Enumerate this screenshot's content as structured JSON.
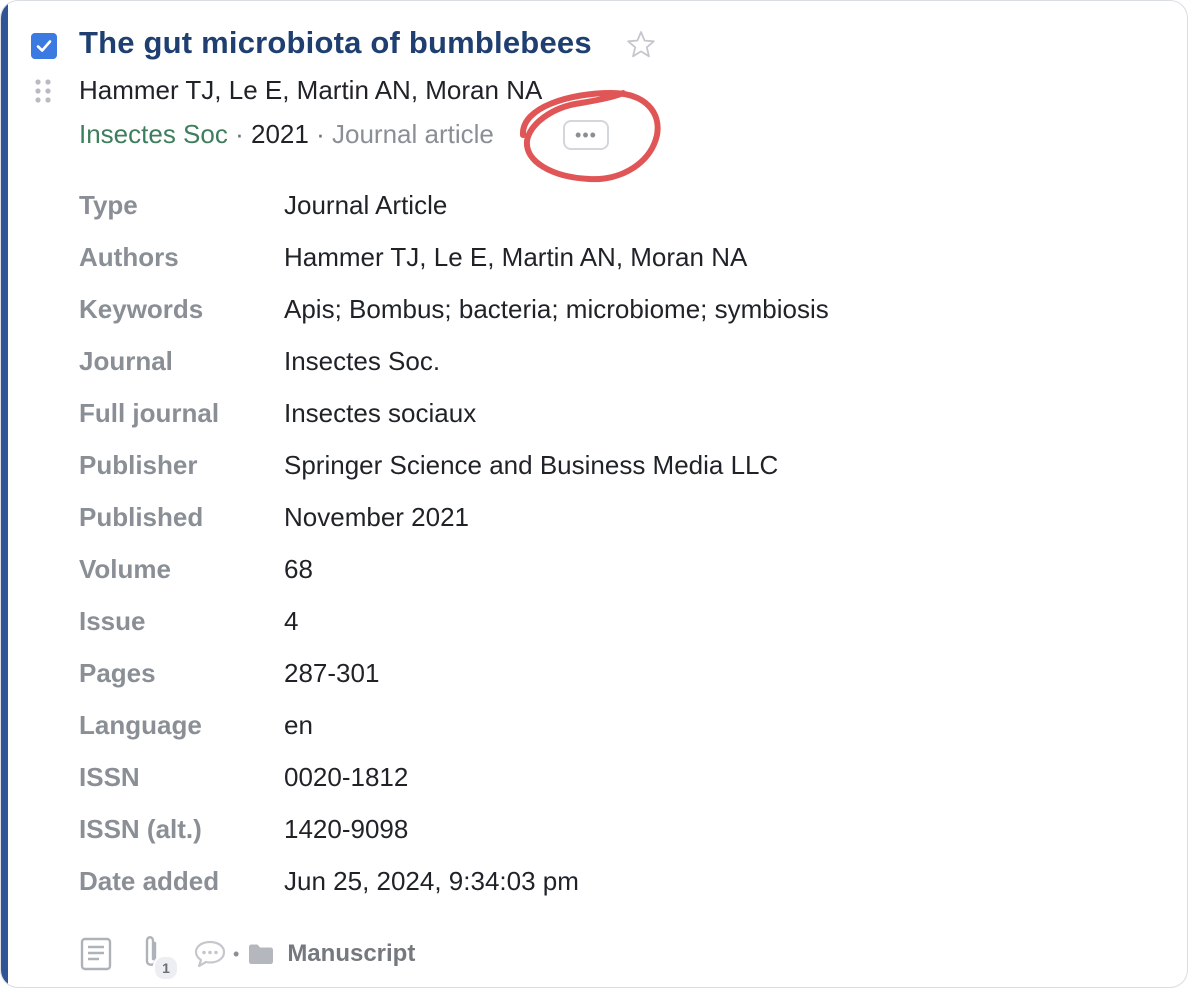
{
  "item": {
    "selected": true,
    "starred": false,
    "title": "The gut microbiota of bumblebees",
    "authors": "Hammer TJ, Le E, Martin AN, Moran NA",
    "journal_abbrev": "Insectes Soc",
    "year": "2021",
    "type_short": "Journal article",
    "separator": "·",
    "more_button_label": "•••"
  },
  "fields": [
    {
      "label": "Type",
      "value": "Journal Article"
    },
    {
      "label": "Authors",
      "value": "Hammer TJ, Le E, Martin AN, Moran NA"
    },
    {
      "label": "Keywords",
      "value": "Apis; Bombus; bacteria; microbiome; symbiosis"
    },
    {
      "label": "Journal",
      "value": "Insectes Soc."
    },
    {
      "label": "Full journal",
      "value": "Insectes sociaux"
    },
    {
      "label": "Publisher",
      "value": "Springer Science and Business Media LLC"
    },
    {
      "label": "Published",
      "value": "November 2021"
    },
    {
      "label": "Volume",
      "value": "68"
    },
    {
      "label": "Issue",
      "value": "4"
    },
    {
      "label": "Pages",
      "value": "287-301"
    },
    {
      "label": "Language",
      "value": "en"
    },
    {
      "label": "ISSN",
      "value": "0020-1812"
    },
    {
      "label": "ISSN (alt.)",
      "value": "1420-9098"
    },
    {
      "label": "Date added",
      "value": "Jun 25, 2024, 9:34:03 pm"
    }
  ],
  "footer": {
    "attachment_count": "1",
    "dot": "•",
    "collection": "Manuscript"
  },
  "icons": {
    "checkbox": "checkbox-checked-icon",
    "star": "star-outline-icon",
    "drag": "drag-handle-icon",
    "notes": "notes-icon",
    "attachments": "paperclip-icon",
    "comments": "comment-icon",
    "folder": "folder-icon"
  },
  "colors": {
    "accent_bar": "#2f5596",
    "title": "#1e3f70",
    "checkbox": "#3b7ae0",
    "journal": "#3f7e5c",
    "muted": "#8a8f96",
    "annotation": "#e05555"
  }
}
